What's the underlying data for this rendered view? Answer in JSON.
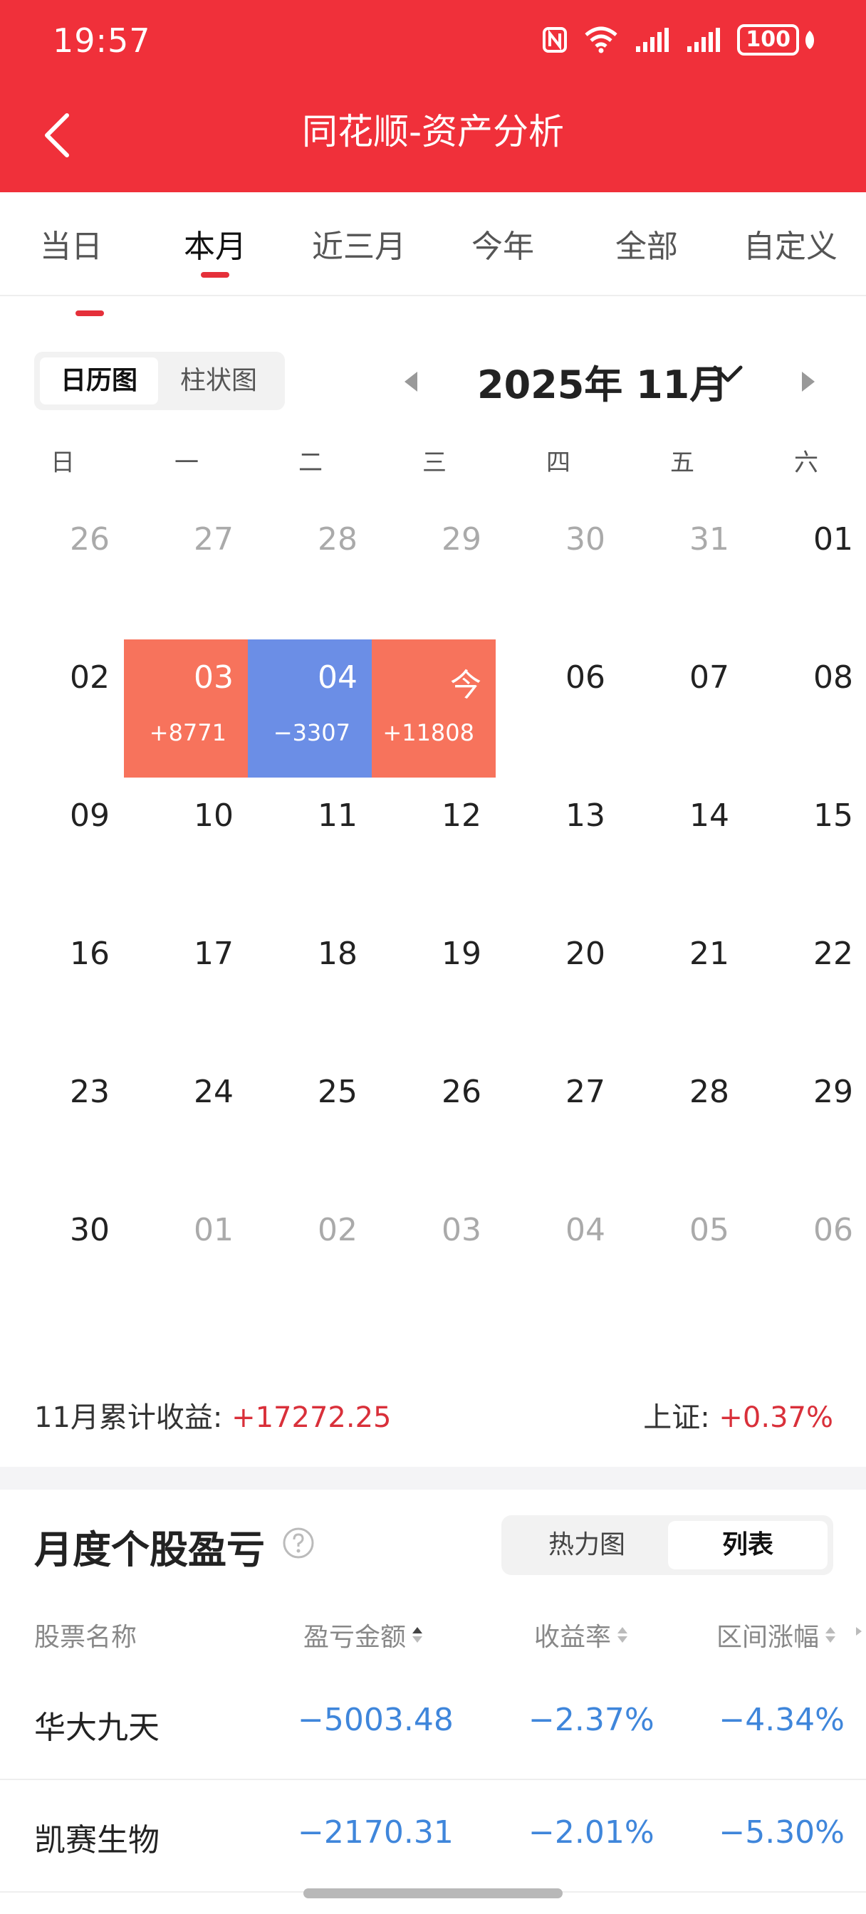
{
  "status": {
    "time": "19:57",
    "battery": "100"
  },
  "header": {
    "title": "同花顺-资产分析"
  },
  "tabs": [
    "当日",
    "本月",
    "近三月",
    "今年",
    "全部",
    "自定义"
  ],
  "view_toggle": {
    "calendar": "日历图",
    "bar": "柱状图"
  },
  "month_label": "2025年 11月",
  "weekdays": [
    "日",
    "一",
    "二",
    "三",
    "四",
    "五",
    "六"
  ],
  "calendar": {
    "w1": [
      "26",
      "27",
      "28",
      "29",
      "30",
      "31",
      "01"
    ],
    "w2": [
      "02",
      "03",
      "04",
      "今",
      "06",
      "07",
      "08"
    ],
    "w3": [
      "09",
      "10",
      "11",
      "12",
      "13",
      "14",
      "15"
    ],
    "w4": [
      "16",
      "17",
      "18",
      "19",
      "20",
      "21",
      "22"
    ],
    "w5": [
      "23",
      "24",
      "25",
      "26",
      "27",
      "28",
      "29"
    ],
    "w6": [
      "30",
      "01",
      "02",
      "03",
      "04",
      "05",
      "06"
    ],
    "pnl": {
      "d03": "+8771",
      "d04": "−3307",
      "today": "+11808"
    }
  },
  "summary": {
    "month_label": "11月累计收益:",
    "month_value": "+17272.25",
    "index_label": "上证:",
    "index_value": "+0.37%"
  },
  "stocks": {
    "title": "月度个股盈亏",
    "seg": {
      "heatmap": "热力图",
      "list": "列表"
    },
    "columns": {
      "name": "股票名称",
      "pnl": "盈亏金额",
      "rate": "收益率",
      "range": "区间涨幅"
    },
    "rows": [
      {
        "name": "华大九天",
        "pnl": "−5003.48",
        "rate": "−2.37%",
        "range": "−4.34%"
      },
      {
        "name": "凯赛生物",
        "pnl": "−2170.31",
        "rate": "−2.01%",
        "range": "−5.30%"
      }
    ]
  },
  "colors": {
    "brand": "#f0303a",
    "gain": "#f7735c",
    "loss": "#6b8ee6",
    "negative_text": "#3f86db"
  }
}
